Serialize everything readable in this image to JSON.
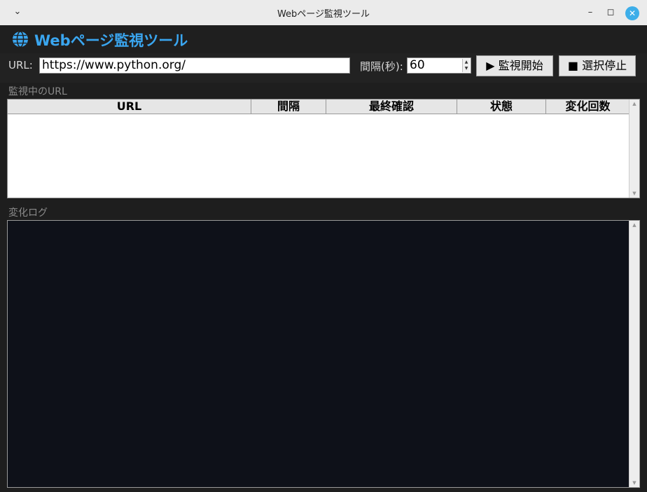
{
  "window": {
    "title": "Webページ監視ツール",
    "menu_icon": "chevron-down-icon",
    "minimize_icon": "minimize-icon",
    "maximize_icon": "maximize-icon",
    "close_icon": "close-icon"
  },
  "header": {
    "icon": "globe-icon",
    "title": "Webページ監視ツール",
    "title_color": "#3aa6f0"
  },
  "controls": {
    "url_label": "URL:",
    "url_value": "https://www.python.org/",
    "interval_label": "間隔(秒):",
    "interval_value": "60",
    "start_button": "▶ 監視開始",
    "stop_button": "■ 選択停止"
  },
  "monitor": {
    "section_label": "監視中のURL",
    "columns": [
      "URL",
      "間隔",
      "最終確認",
      "状態",
      "変化回数"
    ],
    "rows": []
  },
  "log": {
    "section_label": "変化ログ",
    "background": "#0e1119",
    "entries": []
  }
}
